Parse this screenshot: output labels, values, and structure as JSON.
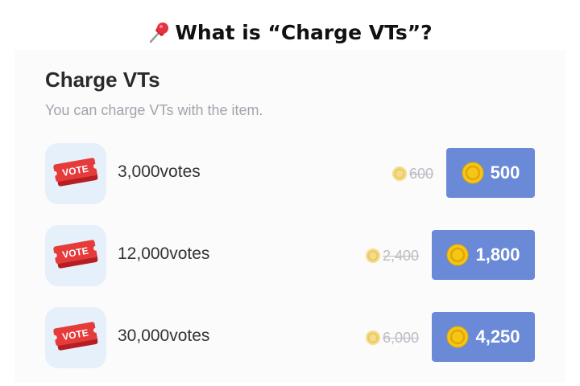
{
  "heading": {
    "text": "What is “Charge VTs”?",
    "icon": "pushpin-icon"
  },
  "panel": {
    "title": "Charge VTs",
    "subtitle": "You can charge VTs with the item."
  },
  "items": [
    {
      "icon_text": "VOTE",
      "votes": "3,000votes",
      "old_price": "600",
      "price": "500"
    },
    {
      "icon_text": "VOTE",
      "votes": "12,000votes",
      "old_price": "2,400",
      "price": "1,800"
    },
    {
      "icon_text": "VOTE",
      "votes": "30,000votes",
      "old_price": "6,000",
      "price": "4,250"
    }
  ],
  "colors": {
    "button": "#6a8ad8",
    "icon_bg": "#e6f0fb",
    "ticket_red": "#e63b3b",
    "coin_gold": "#f5c518"
  }
}
